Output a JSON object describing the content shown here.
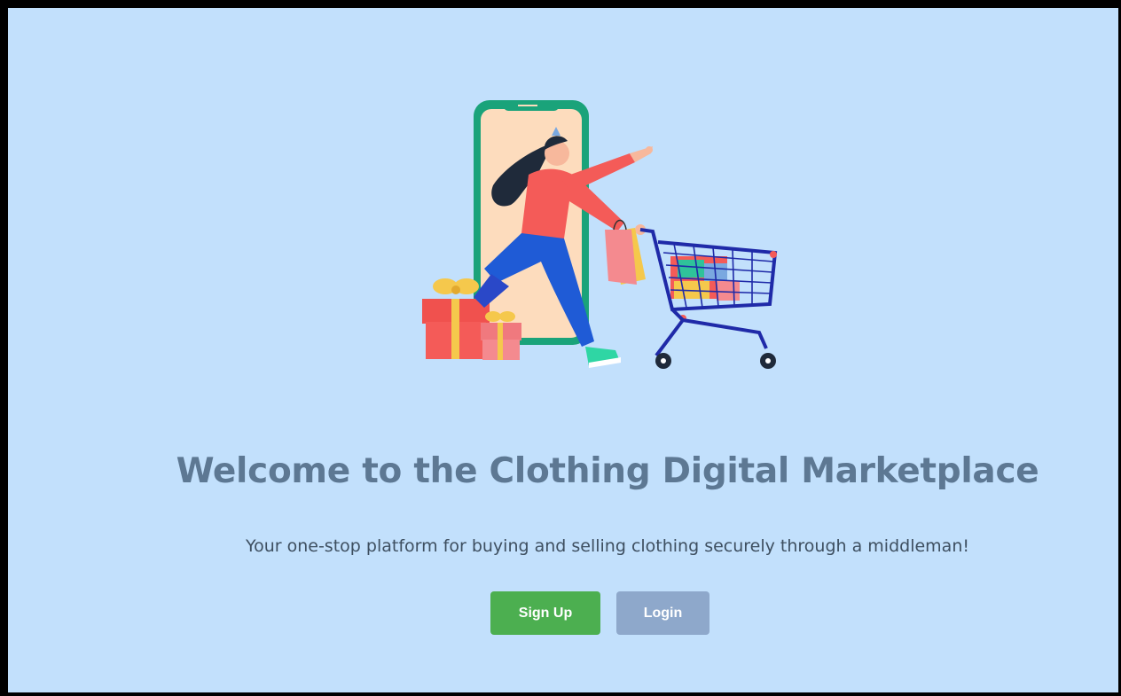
{
  "hero": {
    "title": "Welcome to the Clothing Digital Marketplace",
    "tagline": "Your one-stop platform for buying and selling clothing securely through a middleman!"
  },
  "actions": {
    "signup_label": "Sign Up",
    "login_label": "Login"
  },
  "colors": {
    "page_background": "#c2e0fc",
    "title": "#5d7893",
    "signup_button": "#4caf50",
    "login_button": "#8ea8cb"
  },
  "illustration": {
    "icon": "shopping-woman-with-cart-illustration"
  }
}
